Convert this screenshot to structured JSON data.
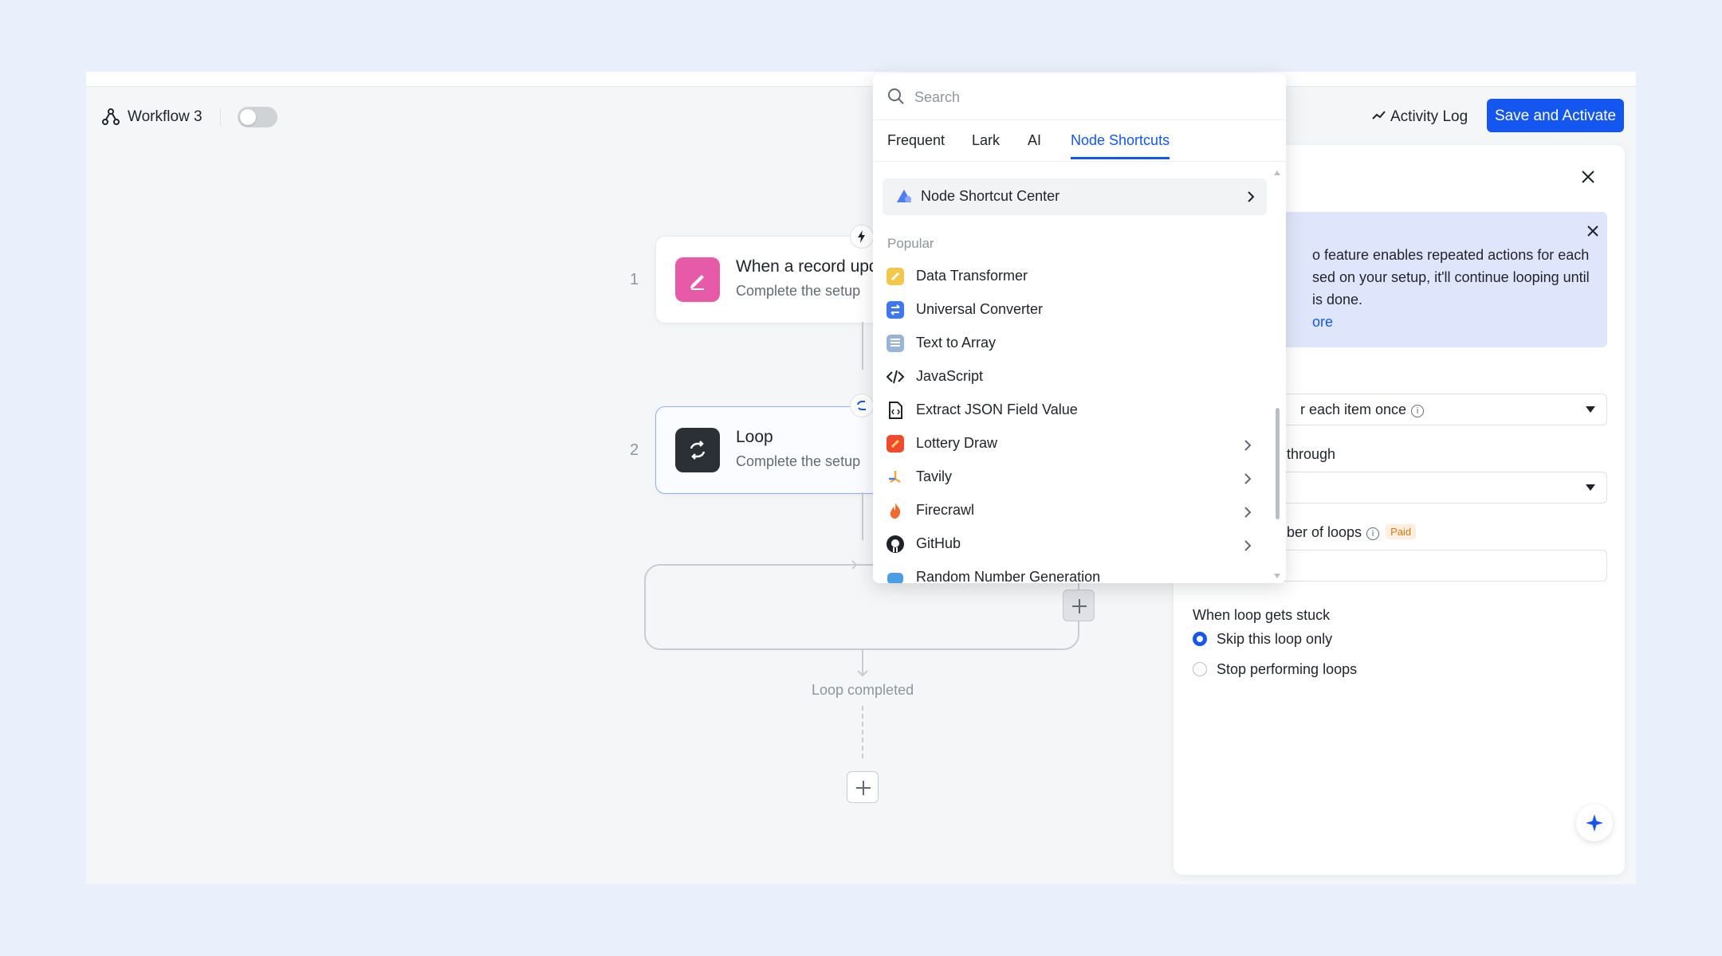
{
  "toolbar": {
    "workflow_title": "Workflow 3",
    "activity_log": "Activity Log",
    "save_activate": "Save and Activate"
  },
  "canvas": {
    "nodes": [
      {
        "step": "1",
        "title": "When a record upd",
        "subtitle": "Complete the setup",
        "icon": "pencil-icon",
        "color": "#e75aa7"
      },
      {
        "step": "2",
        "title": "Loop",
        "subtitle": "Complete the setup",
        "icon": "loop-icon",
        "color": "#2b2f36"
      }
    ],
    "loop_completed": "Loop completed"
  },
  "dropdown": {
    "search_placeholder": "Search",
    "tabs": [
      "Frequent",
      "Lark",
      "AI",
      "Node Shortcuts"
    ],
    "active_tab": "Node Shortcuts",
    "shortcut_center": "Node Shortcut Center",
    "section_title": "Popular",
    "items": [
      {
        "label": "Data Transformer",
        "icon": "data-transformer-icon",
        "has_submenu": false
      },
      {
        "label": "Universal Converter",
        "icon": "universal-converter-icon",
        "has_submenu": false
      },
      {
        "label": "Text to Array",
        "icon": "text-to-array-icon",
        "has_submenu": false
      },
      {
        "label": "JavaScript",
        "icon": "code-icon",
        "has_submenu": false
      },
      {
        "label": "Extract JSON Field Value",
        "icon": "json-file-icon",
        "has_submenu": false
      },
      {
        "label": "Lottery Draw",
        "icon": "lottery-icon",
        "has_submenu": true
      },
      {
        "label": "Tavily",
        "icon": "tavily-icon",
        "has_submenu": true
      },
      {
        "label": "Firecrawl",
        "icon": "fire-icon",
        "has_submenu": true
      },
      {
        "label": "GitHub",
        "icon": "github-icon",
        "has_submenu": true
      },
      {
        "label": "Random Number Generation",
        "icon": "random-number-icon",
        "has_submenu": false
      }
    ]
  },
  "panel": {
    "info_lines": [
      "o feature enables repeated actions for each",
      "sed on your setup, it'll continue looping until",
      " is done."
    ],
    "info_link": "ore",
    "loop_mode_value": "r each item once",
    "loop_through_label": "through",
    "max_loops_label": "ber of loops",
    "paid_badge": "Paid",
    "stuck_label": "When loop gets stuck",
    "radio_options": [
      {
        "label": "Skip this loop only",
        "selected": true
      },
      {
        "label": "Stop performing loops",
        "selected": false
      }
    ]
  },
  "colors": {
    "accent": "#1456f0",
    "background": "#e9effb"
  }
}
